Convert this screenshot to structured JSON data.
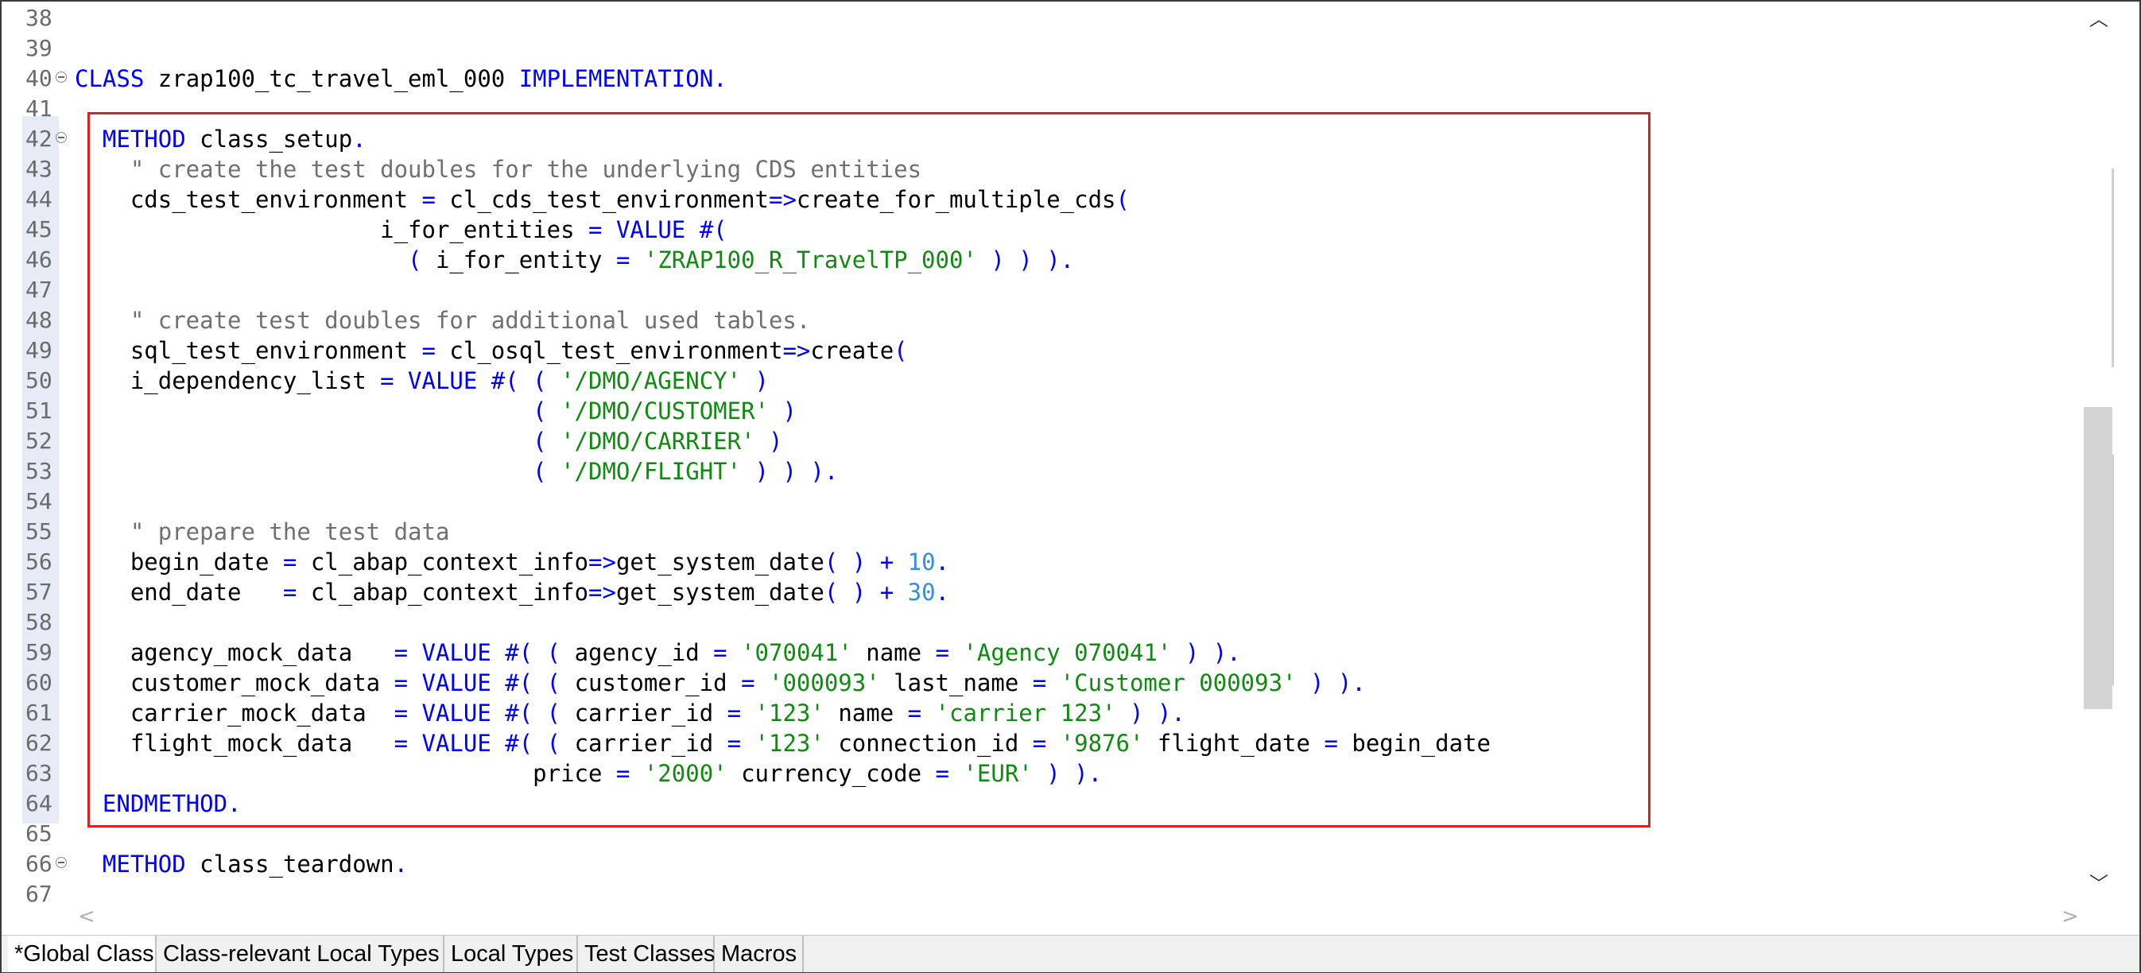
{
  "editor": {
    "lines": [
      {
        "n": "38",
        "fold": false,
        "segs": []
      },
      {
        "n": "39",
        "fold": false,
        "segs": []
      },
      {
        "n": "40",
        "fold": true,
        "indent": "",
        "segs": [
          [
            "kw",
            "CLASS"
          ],
          [
            "t",
            " zrap100_tc_travel_eml_000 "
          ],
          [
            "kw",
            "IMPLEMENTATION."
          ]
        ]
      },
      {
        "n": "41",
        "fold": false,
        "segs": []
      },
      {
        "n": "42",
        "fold": true,
        "segs": [
          [
            "t",
            "  "
          ],
          [
            "kw",
            "METHOD"
          ],
          [
            "t",
            " class_setup"
          ],
          [
            "kw",
            "."
          ]
        ]
      },
      {
        "n": "43",
        "fold": false,
        "segs": [
          [
            "cmt",
            "    \" create the test doubles for the underlying CDS entities"
          ]
        ]
      },
      {
        "n": "44",
        "fold": false,
        "segs": [
          [
            "t",
            "    cds_test_environment "
          ],
          [
            "op",
            "="
          ],
          [
            "t",
            " cl_cds_test_environment"
          ],
          [
            "op",
            "=>"
          ],
          [
            "t",
            "create_for_multiple_cds"
          ],
          [
            "op",
            "("
          ]
        ]
      },
      {
        "n": "45",
        "fold": false,
        "segs": [
          [
            "t",
            "                      i_for_entities "
          ],
          [
            "op",
            "="
          ],
          [
            "kw",
            " VALUE #("
          ]
        ]
      },
      {
        "n": "46",
        "fold": false,
        "segs": [
          [
            "t",
            "                        "
          ],
          [
            "op",
            "("
          ],
          [
            "t",
            " i_for_entity "
          ],
          [
            "op",
            "="
          ],
          [
            "str",
            " 'ZRAP100_R_TravelTP_000'"
          ],
          [
            "op",
            " ) ) )."
          ]
        ]
      },
      {
        "n": "47",
        "fold": false,
        "segs": []
      },
      {
        "n": "48",
        "fold": false,
        "segs": [
          [
            "cmt",
            "    \" create test doubles for additional used tables."
          ]
        ]
      },
      {
        "n": "49",
        "fold": false,
        "segs": [
          [
            "t",
            "    sql_test_environment "
          ],
          [
            "op",
            "="
          ],
          [
            "t",
            " cl_osql_test_environment"
          ],
          [
            "op",
            "=>"
          ],
          [
            "t",
            "create"
          ],
          [
            "op",
            "("
          ]
        ]
      },
      {
        "n": "50",
        "fold": false,
        "segs": [
          [
            "t",
            "    i_dependency_list "
          ],
          [
            "op",
            "="
          ],
          [
            "kw",
            " VALUE #( ( "
          ],
          [
            "str",
            "'/DMO/AGENCY'"
          ],
          [
            "op",
            " )"
          ]
        ]
      },
      {
        "n": "51",
        "fold": false,
        "segs": [
          [
            "t",
            "                                 "
          ],
          [
            "op",
            "( "
          ],
          [
            "str",
            "'/DMO/CUSTOMER'"
          ],
          [
            "op",
            " )"
          ]
        ]
      },
      {
        "n": "52",
        "fold": false,
        "segs": [
          [
            "t",
            "                                 "
          ],
          [
            "op",
            "( "
          ],
          [
            "str",
            "'/DMO/CARRIER'"
          ],
          [
            "op",
            " )"
          ]
        ]
      },
      {
        "n": "53",
        "fold": false,
        "segs": [
          [
            "t",
            "                                 "
          ],
          [
            "op",
            "( "
          ],
          [
            "str",
            "'/DMO/FLIGHT'"
          ],
          [
            "op",
            " ) ) )."
          ]
        ]
      },
      {
        "n": "54",
        "fold": false,
        "segs": []
      },
      {
        "n": "55",
        "fold": false,
        "segs": [
          [
            "cmt",
            "    \" prepare the test data"
          ]
        ]
      },
      {
        "n": "56",
        "fold": false,
        "segs": [
          [
            "t",
            "    begin_date "
          ],
          [
            "op",
            "="
          ],
          [
            "t",
            " cl_abap_context_info"
          ],
          [
            "op",
            "=>"
          ],
          [
            "t",
            "get_system_date"
          ],
          [
            "op",
            "( ) + "
          ],
          [
            "num",
            "10"
          ],
          [
            "op",
            "."
          ]
        ]
      },
      {
        "n": "57",
        "fold": false,
        "segs": [
          [
            "t",
            "    end_date   "
          ],
          [
            "op",
            "="
          ],
          [
            "t",
            " cl_abap_context_info"
          ],
          [
            "op",
            "=>"
          ],
          [
            "t",
            "get_system_date"
          ],
          [
            "op",
            "( ) + "
          ],
          [
            "num",
            "30"
          ],
          [
            "op",
            "."
          ]
        ]
      },
      {
        "n": "58",
        "fold": false,
        "segs": []
      },
      {
        "n": "59",
        "fold": false,
        "segs": [
          [
            "t",
            "    agency_mock_data   "
          ],
          [
            "op",
            "="
          ],
          [
            "kw",
            " VALUE #( ( "
          ],
          [
            "t",
            "agency_id "
          ],
          [
            "op",
            "="
          ],
          [
            "str",
            " '070041'"
          ],
          [
            "t",
            " name "
          ],
          [
            "op",
            "="
          ],
          [
            "str",
            " 'Agency 070041'"
          ],
          [
            "op",
            " ) )."
          ]
        ]
      },
      {
        "n": "60",
        "fold": false,
        "segs": [
          [
            "t",
            "    customer_mock_data "
          ],
          [
            "op",
            "="
          ],
          [
            "kw",
            " VALUE #( ( "
          ],
          [
            "t",
            "customer_id "
          ],
          [
            "op",
            "="
          ],
          [
            "str",
            " '000093'"
          ],
          [
            "t",
            " last_name "
          ],
          [
            "op",
            "="
          ],
          [
            "str",
            " 'Customer 000093'"
          ],
          [
            "op",
            " ) )."
          ]
        ]
      },
      {
        "n": "61",
        "fold": false,
        "segs": [
          [
            "t",
            "    carrier_mock_data  "
          ],
          [
            "op",
            "="
          ],
          [
            "kw",
            " VALUE #( ( "
          ],
          [
            "t",
            "carrier_id "
          ],
          [
            "op",
            "="
          ],
          [
            "str",
            " '123'"
          ],
          [
            "t",
            " name "
          ],
          [
            "op",
            "="
          ],
          [
            "str",
            " 'carrier 123'"
          ],
          [
            "op",
            " ) )."
          ]
        ]
      },
      {
        "n": "62",
        "fold": false,
        "segs": [
          [
            "t",
            "    flight_mock_data   "
          ],
          [
            "op",
            "="
          ],
          [
            "kw",
            " VALUE #( ( "
          ],
          [
            "t",
            "carrier_id "
          ],
          [
            "op",
            "="
          ],
          [
            "str",
            " '123'"
          ],
          [
            "t",
            " connection_id "
          ],
          [
            "op",
            "="
          ],
          [
            "str",
            " '9876'"
          ],
          [
            "t",
            " flight_date "
          ],
          [
            "op",
            "="
          ],
          [
            "t",
            " begin_date"
          ]
        ]
      },
      {
        "n": "63",
        "fold": false,
        "segs": [
          [
            "t",
            "                                 price "
          ],
          [
            "op",
            "="
          ],
          [
            "str",
            " '2000'"
          ],
          [
            "t",
            " currency_code "
          ],
          [
            "op",
            "="
          ],
          [
            "str",
            " 'EUR'"
          ],
          [
            "op",
            " ) )."
          ]
        ]
      },
      {
        "n": "64",
        "fold": false,
        "segs": [
          [
            "t",
            "  "
          ],
          [
            "kw",
            "ENDMETHOD."
          ]
        ]
      },
      {
        "n": "65",
        "fold": false,
        "segs": []
      },
      {
        "n": "66",
        "fold": true,
        "segs": [
          [
            "t",
            "  "
          ],
          [
            "kw",
            "METHOD"
          ],
          [
            "t",
            " class_teardown"
          ],
          [
            "kw",
            "."
          ]
        ]
      },
      {
        "n": "67",
        "fold": false,
        "segs": []
      }
    ]
  },
  "scrollbar": {
    "up_glyph": "︿",
    "down_glyph": "﹀",
    "left_glyph": "<",
    "right_glyph": ">"
  },
  "tabs": [
    {
      "label": "*Global Class",
      "active": true
    },
    {
      "label": "Class-relevant Local Types",
      "active": false
    },
    {
      "label": "Local Types",
      "active": false
    },
    {
      "label": "Test Classes",
      "active": false
    },
    {
      "label": "Macros",
      "active": false
    }
  ],
  "colors": {
    "keyword": "#0000ff",
    "string": "#118a11",
    "number": "#2f8fe0",
    "comment": "#707070",
    "highlight_box": "#e02020"
  }
}
